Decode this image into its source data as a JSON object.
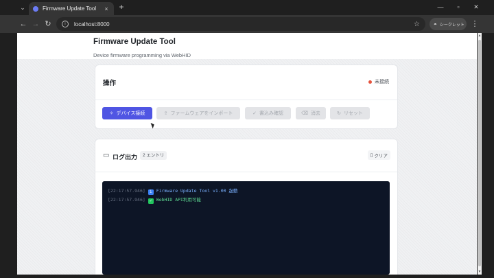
{
  "browser": {
    "tab_title": "Firmware Update Tool",
    "tab_close": "×",
    "new_tab": "+",
    "url": "localhost:8000",
    "incognito_label": "シークレット"
  },
  "app": {
    "title": "Firmware Update Tool",
    "subtitle": "Device firmware programming via WebHID"
  },
  "operations": {
    "title": "操作",
    "status": "未接続",
    "buttons": [
      {
        "label": "デバイス接続",
        "state": "enabled",
        "icon": "plug-icon"
      },
      {
        "label": "ファームウェアをインポート",
        "state": "disabled",
        "icon": "upload-icon"
      },
      {
        "label": "書込み確認",
        "state": "disabled",
        "icon": "check-icon"
      },
      {
        "label": "消去",
        "state": "disabled",
        "icon": "trash-icon"
      },
      {
        "label": "リセット",
        "state": "disabled",
        "icon": "refresh-icon"
      }
    ]
  },
  "log": {
    "title": "ログ出力",
    "count": "2 エントリ",
    "clear_label": "クリア",
    "entries": [
      {
        "time": "[22:17:57.946]",
        "type": "info",
        "message": "Firmware Update Tool v1.00 起動"
      },
      {
        "time": "[22:17:57.946]",
        "type": "ok",
        "message": "WebHID API利用可能"
      }
    ]
  },
  "colors": {
    "primary": "#4f55e3",
    "status_disconnected": "#e5533d",
    "console_bg": "#0d1526"
  }
}
